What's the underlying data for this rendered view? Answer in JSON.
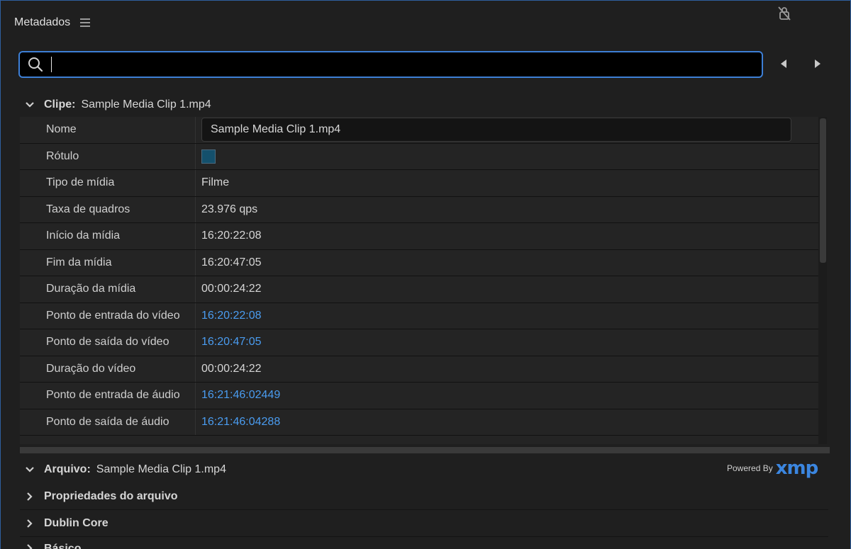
{
  "panel": {
    "title": "Metadados"
  },
  "search": {
    "placeholder": "",
    "value": ""
  },
  "clip_section": {
    "label": "Clipe:",
    "value": "Sample Media Clip 1.mp4"
  },
  "rows": [
    {
      "label": "Nome",
      "value": "Sample Media Clip 1.mp4",
      "kind": "field"
    },
    {
      "label": "Rótulo",
      "value": "",
      "kind": "swatch"
    },
    {
      "label": "Tipo de mídia",
      "value": "Filme",
      "kind": "text"
    },
    {
      "label": "Taxa de quadros",
      "value": "23.976 qps",
      "kind": "text"
    },
    {
      "label": "Início da mídia",
      "value": "16:20:22:08",
      "kind": "text"
    },
    {
      "label": "Fim da mídia",
      "value": "16:20:47:05",
      "kind": "text"
    },
    {
      "label": "Duração da mídia",
      "value": "00:00:24:22",
      "kind": "text"
    },
    {
      "label": "Ponto de entrada do vídeo",
      "value": "16:20:22:08",
      "kind": "link"
    },
    {
      "label": "Ponto de saída do vídeo",
      "value": "16:20:47:05",
      "kind": "link"
    },
    {
      "label": "Duração do vídeo",
      "value": "00:00:24:22",
      "kind": "text"
    },
    {
      "label": "Ponto de entrada de áudio",
      "value": "16:21:46:02449",
      "kind": "link"
    },
    {
      "label": "Ponto de saída de áudio",
      "value": "16:21:46:04288",
      "kind": "link"
    }
  ],
  "file_section": {
    "label": "Arquivo:",
    "value": "Sample Media Clip 1.mp4"
  },
  "powered_by": {
    "text": "Powered By",
    "logo": "xmp"
  },
  "subsections": [
    "Propriedades do arquivo",
    "Dublin Core",
    "Básico"
  ],
  "colors": {
    "accent": "#3d7fd6",
    "link": "#4a9cf0",
    "label_swatch": "#14506c"
  }
}
